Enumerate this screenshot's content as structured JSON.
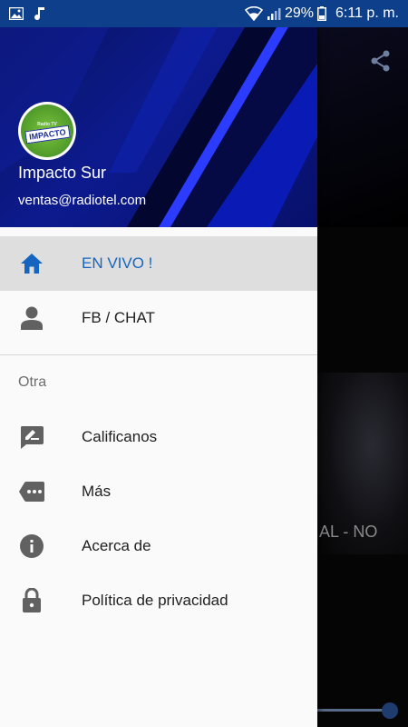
{
  "status_bar": {
    "battery": "29%",
    "time": "6:11 p. m.",
    "icons": [
      "image-icon",
      "music-note-icon",
      "wifi-icon",
      "signal-icon",
      "battery-icon"
    ]
  },
  "drawer": {
    "header": {
      "logo_text": "IMPACTO",
      "logo_subtext": "Radio TV",
      "name": "Impacto Sur",
      "email": "ventas@radiotel.com"
    },
    "primary_items": [
      {
        "label": "EN VIVO !",
        "icon": "home-icon",
        "active": true
      },
      {
        "label": "FB / CHAT",
        "icon": "person-icon",
        "active": false
      }
    ],
    "section_title": "Otra",
    "secondary_items": [
      {
        "label": "Calificanos",
        "icon": "rate-review-icon"
      },
      {
        "label": "Más",
        "icon": "more-tag-icon"
      },
      {
        "label": "Acerca de",
        "icon": "info-icon"
      },
      {
        "label": "Política de privacidad",
        "icon": "lock-icon"
      }
    ]
  },
  "background_app": {
    "now_playing_fragment": "AL - NO",
    "share_icon": "share-icon",
    "seek_progress": 0.9
  },
  "colors": {
    "status_bar": "#0d3f8a",
    "accent": "#1565c0",
    "active_row": "#dedede",
    "icon_gray": "#616161"
  }
}
